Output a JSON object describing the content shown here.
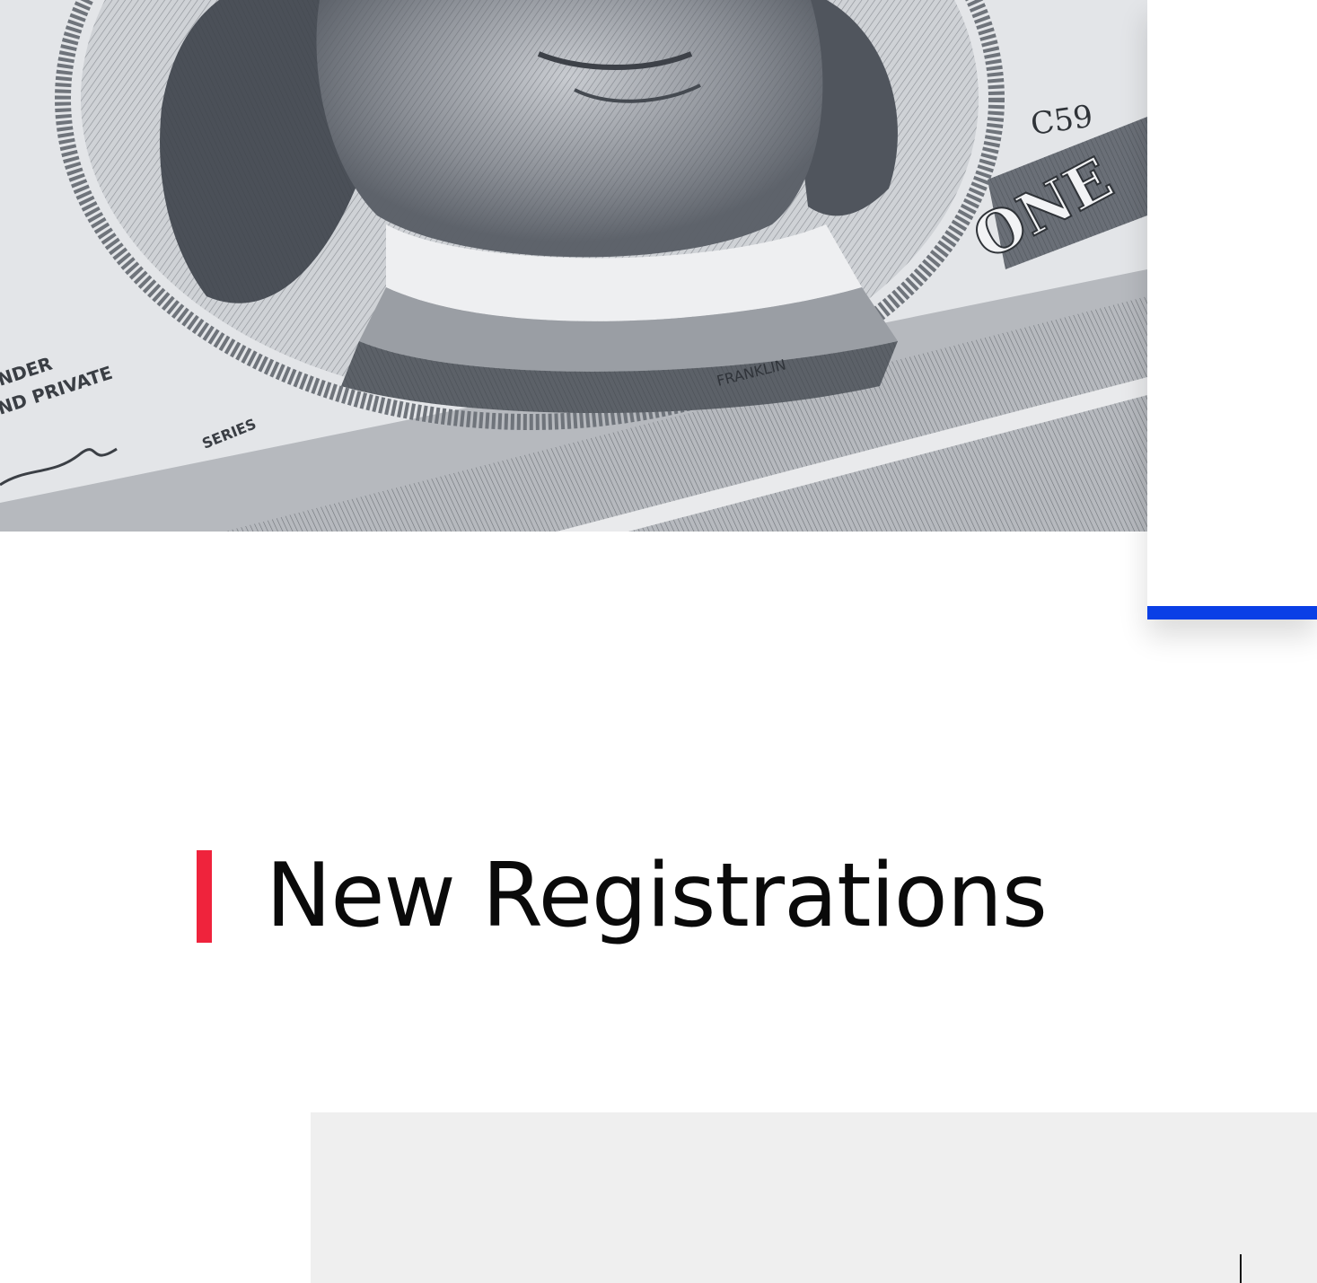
{
  "hero": {
    "image": "banknote-portrait-photo",
    "banknote_text": {
      "serial_fragment": "C59",
      "denomination_word": "ONE",
      "portrait_name": "FRANKLIN",
      "left_text_line1": "NDER",
      "left_text_line2": "ND PRIVATE",
      "series_label": "SERIES"
    }
  },
  "side_card": {
    "accent_color": "#0a3fe6"
  },
  "section": {
    "title": "New Registrations",
    "accent_color": "#ef233c"
  },
  "content_panel": {
    "background": "#efefef"
  }
}
